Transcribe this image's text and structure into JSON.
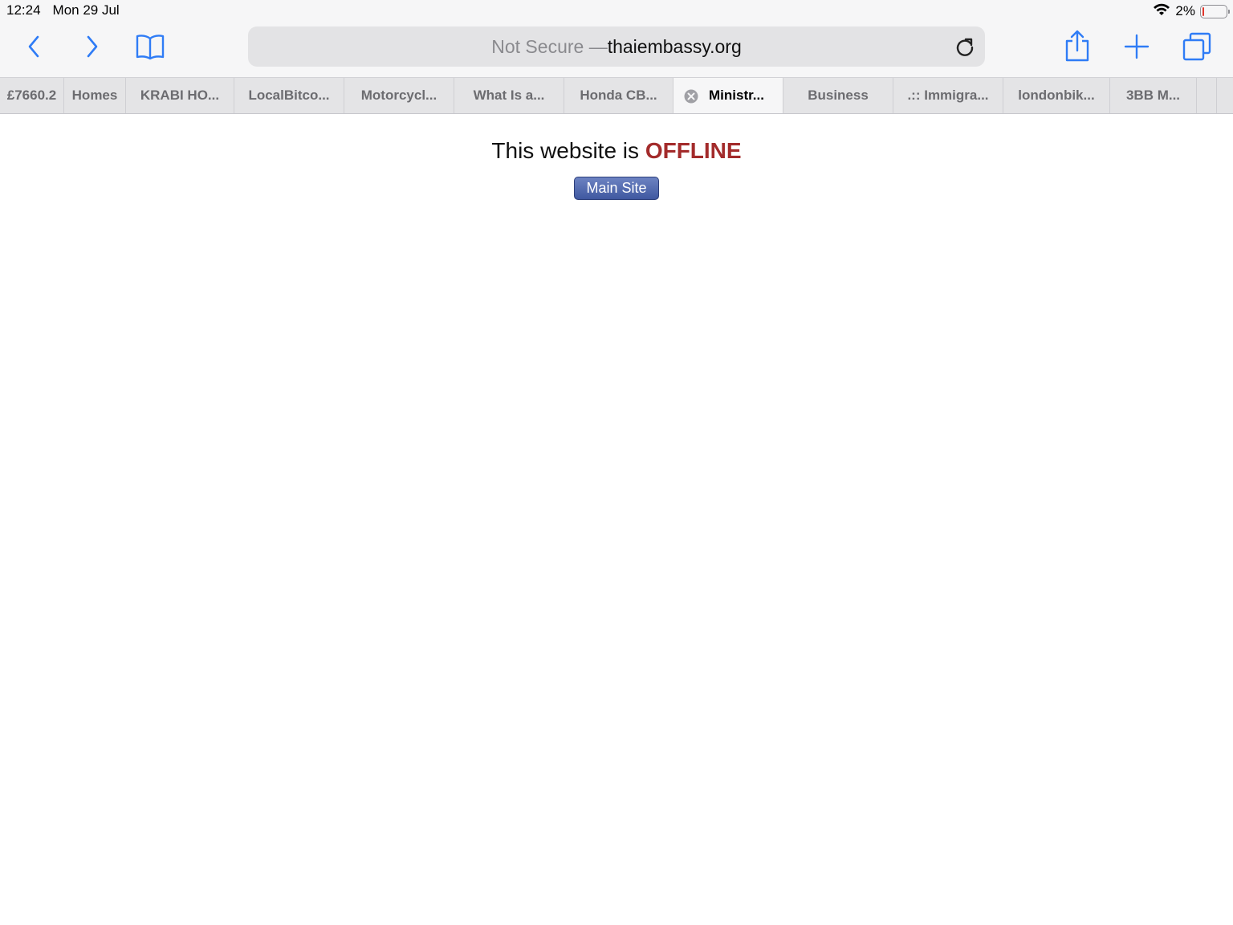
{
  "status_bar": {
    "time": "12:24",
    "date": "Mon 29 Jul",
    "battery_percent": "2%",
    "battery_level": 0.02,
    "wifi_icon": "wifi-icon",
    "battery_color": "#e0362c"
  },
  "toolbar": {
    "back_icon": "chevron-left-icon",
    "forward_icon": "chevron-right-icon",
    "bookmarks_icon": "book-icon",
    "share_icon": "share-icon",
    "new_tab_icon": "plus-icon",
    "tabs_icon": "tabs-icon",
    "reload_icon": "reload-icon",
    "accent_color": "#2f7cf6"
  },
  "address_bar": {
    "security_label": "Not Secure — ",
    "domain": "thaiembassy.org"
  },
  "tabs": [
    {
      "label": "£7660.2"
    },
    {
      "label": "Homes"
    },
    {
      "label": "KRABI HO..."
    },
    {
      "label": "LocalBitco..."
    },
    {
      "label": "Motorcycl..."
    },
    {
      "label": "What Is a..."
    },
    {
      "label": "Honda CB..."
    },
    {
      "label": "Ministr...",
      "active": true
    },
    {
      "label": "Business"
    },
    {
      "label": ".:: Immigra..."
    },
    {
      "label": "londonbik..."
    },
    {
      "label": "3BB M..."
    },
    {
      "label": ""
    },
    {
      "label": ""
    }
  ],
  "page": {
    "heading_prefix": "This website is ",
    "heading_status": "OFFLINE",
    "status_color": "#a32b2b",
    "button_label": "Main Site"
  }
}
